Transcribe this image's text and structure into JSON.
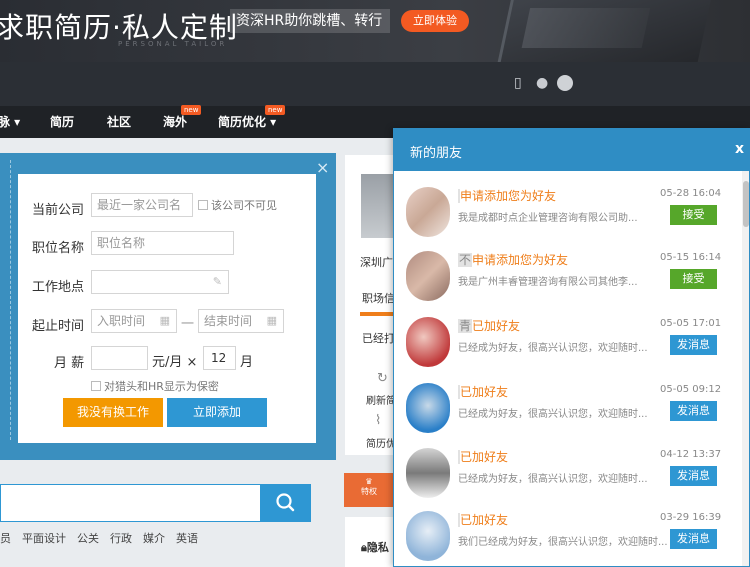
{
  "banner": {
    "title": "求职简历·私人定制",
    "subtitle": "PERSONAL TAILOR",
    "slogan": "资深HR助你跳槽、转行",
    "cta": "立即体验"
  },
  "topbar": {
    "icons": [
      "mobile-icon",
      "user-icon",
      "avatar-icon"
    ]
  },
  "nav": {
    "items": [
      {
        "label": "脉 ▾"
      },
      {
        "label": "简历"
      },
      {
        "label": "社区"
      },
      {
        "label": "海外",
        "badge": "new"
      },
      {
        "label": "简历优化 ▾",
        "badge": "new"
      }
    ]
  },
  "form": {
    "company_label": "当前公司",
    "company_placeholder": "最近一家公司名",
    "company_hidden": "该公司不可见",
    "position_label": "职位名称",
    "position_placeholder": "职位名称",
    "location_label": "工作地点",
    "period_label": "起止时间",
    "start_placeholder": "入职时间",
    "period_sep": "一",
    "end_placeholder": "结束时间",
    "salary_label": "月 薪",
    "salary_unit": "元/月 ×",
    "salary_months": "12",
    "months_unit": "月",
    "confidential": "对猎头和HR显示为保密",
    "btn_no_job": "我没有换工作",
    "btn_add": "立即添加"
  },
  "search": {
    "placeholder": "",
    "tags": [
      "员",
      "平面设计",
      "公关",
      "行政",
      "媒介",
      "英语"
    ]
  },
  "mid": {
    "line1": "深圳广",
    "line2": "职场信",
    "line3": "已经打",
    "line4": "刷新简",
    "line5": "简历优",
    "vip": "特权",
    "privacy": "隐私"
  },
  "popup": {
    "title": "新的朋友",
    "close": "x",
    "friends": [
      {
        "name": "",
        "action": "申请添加您为好友",
        "msg": "我是成都时点企业管理咨询有限公司助...",
        "time": "05-28 16:04",
        "btn": "接受",
        "btn_color": "green"
      },
      {
        "name": "不",
        "action": "申请添加您为好友",
        "msg": "我是广州丰睿管理咨询有限公司其他李...",
        "time": "05-15 16:14",
        "btn": "接受",
        "btn_color": "green"
      },
      {
        "name": "青",
        "action": "已加好友",
        "msg": "已经成为好友，很高兴认识您，欢迎随时...",
        "time": "05-05 17:01",
        "btn": "发消息",
        "btn_color": "blue"
      },
      {
        "name": "",
        "action": "已加好友",
        "msg": "已经成为好友，很高兴认识您，欢迎随时...",
        "time": "05-05 09:12",
        "btn": "发消息",
        "btn_color": "blue"
      },
      {
        "name": "",
        "action": "已加好友",
        "msg": "已经成为好友，很高兴认识您，欢迎随时...",
        "time": "04-12 13:37",
        "btn": "发消息",
        "btn_color": "blue"
      },
      {
        "name": "",
        "action": "已加好友",
        "msg": "我们已经成为好友，很高兴认识您，欢迎随时...",
        "time": "03-29 16:39",
        "btn": "发消息",
        "btn_color": "blue"
      }
    ]
  }
}
